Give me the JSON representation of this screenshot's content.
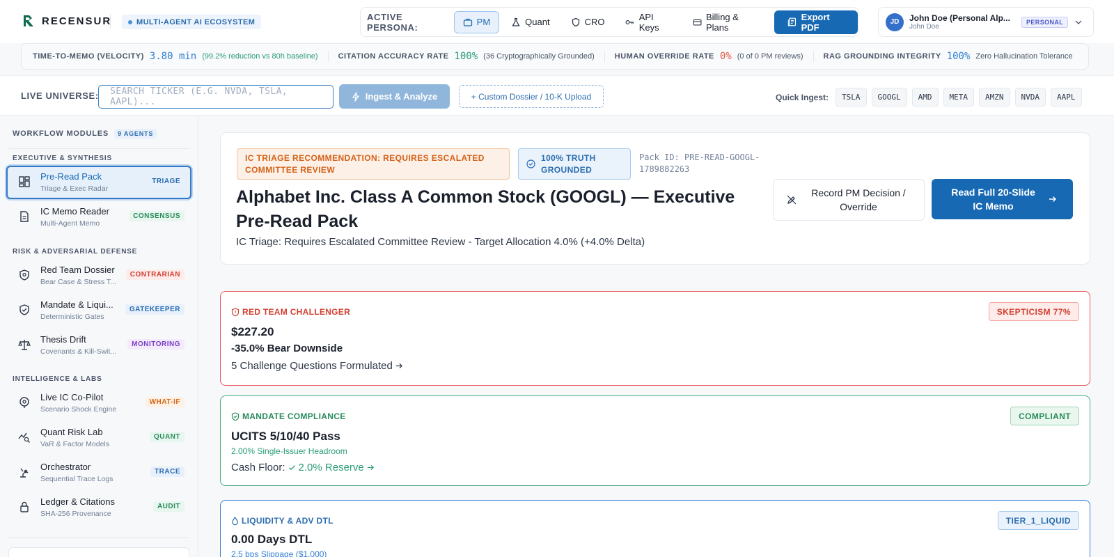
{
  "brand": {
    "name": "RECENSUR",
    "ecosystem": "MULTI-AGENT AI ECOSYSTEM"
  },
  "persona": {
    "label": "ACTIVE PERSONA:",
    "options": [
      "PM",
      "Quant",
      "CRO"
    ],
    "api_keys": "API Keys",
    "billing": "Billing & Plans",
    "export": "Export PDF"
  },
  "user": {
    "initials": "JD",
    "name": "John Doe (Personal Alp...",
    "sub": "John Doe",
    "badge": "PERSONAL"
  },
  "metrics": [
    {
      "label": "TIME-TO-MEMO (VELOCITY)",
      "value": "3.80 min",
      "note": "(99.2% reduction vs 80h baseline)"
    },
    {
      "label": "CITATION ACCURACY RATE",
      "value": "100%",
      "note": "(36 Cryptographically Grounded)"
    },
    {
      "label": "HUMAN OVERRIDE RATE",
      "value": "0%",
      "note": "(0 of 0 PM reviews)"
    },
    {
      "label": "RAG GROUNDING INTEGRITY",
      "value": "100%",
      "note": "Zero Hallucination Tolerance"
    }
  ],
  "ingest": {
    "label": "LIVE UNIVERSE:",
    "search_placeholder": "SEARCH TICKER (E.G. NVDA, TSLA, AAPL)...",
    "analyze": "Ingest & Analyze",
    "upload": "+ Custom Dossier / 10-K Upload",
    "quick_label": "Quick Ingest:",
    "quick": [
      "TSLA",
      "GOOGL",
      "AMD",
      "META",
      "AMZN",
      "NVDA",
      "AAPL"
    ]
  },
  "sidebar": {
    "header": "WORKFLOW MODULES",
    "agents": "9 AGENTS",
    "sections": [
      "EXECUTIVE & SYNTHESIS",
      "RISK & ADVERSARIAL DEFENSE",
      "INTELLIGENCE & LABS"
    ],
    "items": [
      {
        "title": "Pre-Read Pack",
        "sub": "Triage & Exec Radar",
        "tag": "TRIAGE",
        "icon": "layout-grid-icon"
      },
      {
        "title": "IC Memo Reader",
        "sub": "Multi-Agent Memo",
        "tag": "CONSENSUS",
        "icon": "document-icon"
      },
      {
        "title": "Red Team Dossier",
        "sub": "Bear Case & Stress T...",
        "tag": "CONTRARIAN",
        "icon": "shield-alert-icon"
      },
      {
        "title": "Mandate & Liqui...",
        "sub": "Deterministic Gates",
        "tag": "GATEKEEPER",
        "icon": "shield-check-icon"
      },
      {
        "title": "Thesis Drift",
        "sub": "Covenants & Kill-Swit...",
        "tag": "MONITORING",
        "icon": "scale-icon"
      },
      {
        "title": "Live IC Co-Pilot",
        "sub": "Scenario Shock Engine",
        "tag": "WHAT-IF",
        "icon": "radar-icon"
      },
      {
        "title": "Quant Risk Lab",
        "sub": "VaR & Factor Models",
        "tag": "QUANT",
        "icon": "chart-search-icon"
      },
      {
        "title": "Orchestrator",
        "sub": "Sequential Trace Logs",
        "tag": "TRACE",
        "icon": "robot-arm-icon"
      },
      {
        "title": "Ledger & Citations",
        "sub": "SHA-256 Provenance",
        "tag": "AUDIT",
        "icon": "lock-icon"
      }
    ]
  },
  "hero": {
    "triage_badge": "IC TRIAGE RECOMMENDATION: REQUIRES ESCALATED COMMITTEE REVIEW",
    "truth_badge": "100% TRUTH GROUNDED",
    "pack_id": "Pack ID: PRE-READ-GOOGL-1789882263",
    "title": "Alphabet Inc. Class A Common Stock (GOOGL) — Executive Pre-Read Pack",
    "subtitle": "IC Triage: Requires Escalated Committee Review - Target Allocation 4.0% (+4.0% Delta)",
    "record_button": "Record PM Decision / Override",
    "read_button": "Read Full 20-Slide IC Memo"
  },
  "cards": {
    "red_team": {
      "title": "RED TEAM CHALLENGER",
      "badge": "SKEPTICISM 77%",
      "price": "$227.20",
      "downside": "-35.0% Bear Downside",
      "link": "5 Challenge Questions Formulated"
    },
    "mandate": {
      "title": "MANDATE COMPLIANCE",
      "badge": "COMPLIANT",
      "headline": "UCITS 5/10/40 Pass",
      "headroom": "2.00% Single-Issuer Headroom",
      "cash_label": "Cash Floor:",
      "cash_value": "2.0% Reserve"
    },
    "liquidity": {
      "title": "LIQUIDITY & ADV DTL",
      "badge": "TIER_1_LIQUID",
      "headline": "0.00 Days DTL",
      "slippage": "2.5 bps Slippage ($1,000)"
    }
  },
  "colors": {
    "accent": "#1769b3",
    "red": "#e8555b",
    "green": "#4daa7f",
    "blue": "#3d7fd0",
    "orange": "#d4621a"
  }
}
